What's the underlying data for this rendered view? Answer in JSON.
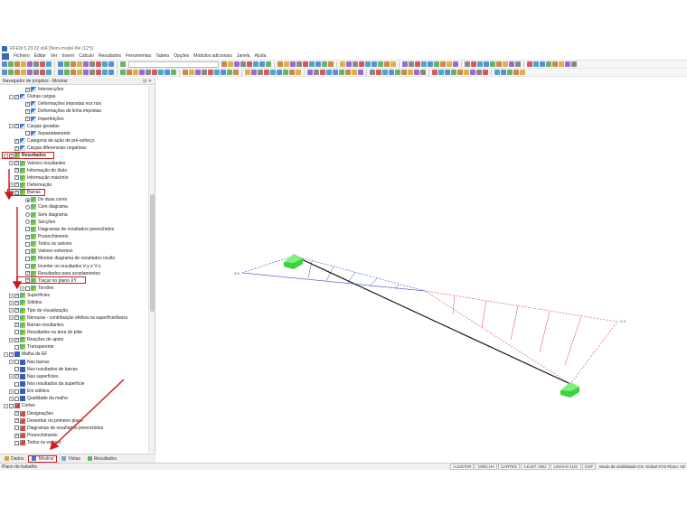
{
  "window": {
    "title": "RFEM 5.23.02 x64   [Nem-model-file (12*)]"
  },
  "menu": [
    "Ficheiro",
    "Editar",
    "Ver",
    "Inserir",
    "Cálculo",
    "Resultados",
    "Ferramentas",
    "Tabela",
    "Opções",
    "Módulos adicionais",
    "Janela",
    "Ajuda"
  ],
  "navigator": {
    "title": "Navegador de projetos - Mostrar",
    "controls": "⊟ ✕",
    "items": {
      "intersecoes": "Intersecções",
      "outras_cargas": "Outras cargas",
      "deformacoes_nos": "Deformações impostas nos nós",
      "deformacoes_linha": "Deformações de linha impostas",
      "imperfeicoes": "Imperfeições",
      "cargas_geradas": "Cargas geradas",
      "separadamente": "Separadamente",
      "categoria_acao": "Categoria de ação de pré-esforço",
      "cargas_diferenciais": "Cargas diferenciais negativas",
      "resultados": "Resultados",
      "valores_resultantes": "Valores resultantes",
      "informacao_titulo": "Informação do título",
      "informacao_maxmin": "Informação máx/mín",
      "deformacao": "Deformação",
      "barras": "Barras",
      "de_duas_cores": "De duas cores",
      "com_diagrama": "Com diagrama",
      "sem_diagrama": "Sem diagrama",
      "seccoes": "Secções",
      "diagramas_preenchidos": "Diagramas de resultados preenchidos",
      "preenchimento": "Preenchimento",
      "todos_valores": "Todos os valores",
      "valores_extremos": "Valores extremos",
      "mostrar_oculto": "Mostrar diagrama de resultados oculto",
      "inverter": "Inverter os resultados V-y e V-z",
      "resultados_acoplamentos": "Resultados para acoplamentos",
      "tracar_plano": "Traçar no plano XY",
      "torsoes": "Torsões",
      "superficies": "Superfícies",
      "solidos": "Sólidos",
      "tipo_visualizacao": "Tipo de visualização",
      "nervuras": "Nervuras - contribuição efetiva na superfície/barra",
      "barras_resultantes": "Barras resultantes",
      "resultados_area_pilar": "Resultados na área do pilar",
      "reacoes_apoio": "Reações de apoio",
      "transparente": "Transparente",
      "malha_ef": "Malha de EF",
      "nas_barras": "Nas barras",
      "nos_resultados_barras": "Nos resultados de barras",
      "nas_superficies": "Nas superfícies",
      "nos_resultados_superficie": "Nos resultados da superfície",
      "em_solidos": "Em sólidos",
      "qualidade_malha": "Qualidade da malha",
      "cortes": "Cortes",
      "designacoes": "Designações",
      "desenhar_primeiro": "Desenhar no primeiro plano",
      "diagramas_resultados_preenchidos": "Diagramas de resultados preenchidos",
      "preenchimento2": "Preenchimento",
      "todos_valores2": "Todos os valores"
    }
  },
  "nav_tabs": [
    "Dados",
    "Mostrar",
    "Vistas",
    "Resultados"
  ],
  "statusbar": {
    "left": "Plano de trabalho",
    "buttons": [
      "AJUSTAR",
      "GRELHA",
      "CARTES",
      "AJUST. OBJ.",
      "LINHAS AUX.",
      "DXF"
    ],
    "info": "Modo de visibilidade  CS: Global XYZ    Plano: XZ"
  },
  "viewport": {
    "label_left": "3.8",
    "label_right": "-0.4"
  },
  "colors": {
    "accent_red": "#cc1b1b",
    "diagram_blue": "#3b4fd6",
    "diagram_red": "#e04848",
    "support_green": "#3fd23f"
  }
}
